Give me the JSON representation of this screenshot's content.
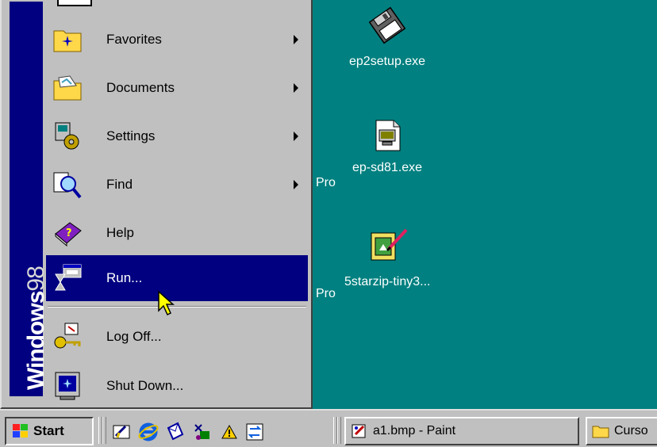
{
  "desktop": {
    "icons": [
      {
        "label": "ep2setup.exe",
        "icon": "floppy-disk-icon"
      },
      {
        "label": "ep-sd81.exe",
        "icon": "setup-program-icon"
      },
      {
        "label": "5starzip-tiny3...",
        "icon": "picture-frame-icon"
      }
    ],
    "partial_labels": [
      "Pro",
      "Pro"
    ]
  },
  "start_menu": {
    "brand_bold": "Windows",
    "brand_light": "98",
    "items": [
      {
        "label": "Favorites",
        "icon": "favorites-folder-icon",
        "submenu": true
      },
      {
        "label": "Documents",
        "icon": "documents-folder-icon",
        "submenu": true
      },
      {
        "label": "Settings",
        "icon": "settings-icon",
        "submenu": true
      },
      {
        "label": "Find",
        "icon": "find-icon",
        "submenu": true
      },
      {
        "label": "Help",
        "icon": "help-book-icon",
        "submenu": false
      },
      {
        "label": "Run...",
        "icon": "run-icon",
        "submenu": false,
        "active": true
      },
      {
        "label": "Log Off...",
        "icon": "log-off-key-icon",
        "submenu": false
      },
      {
        "label": "Shut Down...",
        "icon": "shut-down-icon",
        "submenu": false
      }
    ]
  },
  "taskbar": {
    "start_label": "Start",
    "quick_launch": [
      "show-desktop-icon",
      "internet-explorer-icon",
      "outlook-express-icon",
      "channels-icon",
      "warning-icon",
      "sync-icon"
    ],
    "tasks": [
      {
        "label": "a1.bmp - Paint",
        "icon": "paint-icon"
      },
      {
        "label": "Curso",
        "icon": "folder-icon"
      }
    ]
  },
  "colors": {
    "desktop": "#008080",
    "menu_face": "#c0c0c0",
    "highlight": "#000080"
  }
}
